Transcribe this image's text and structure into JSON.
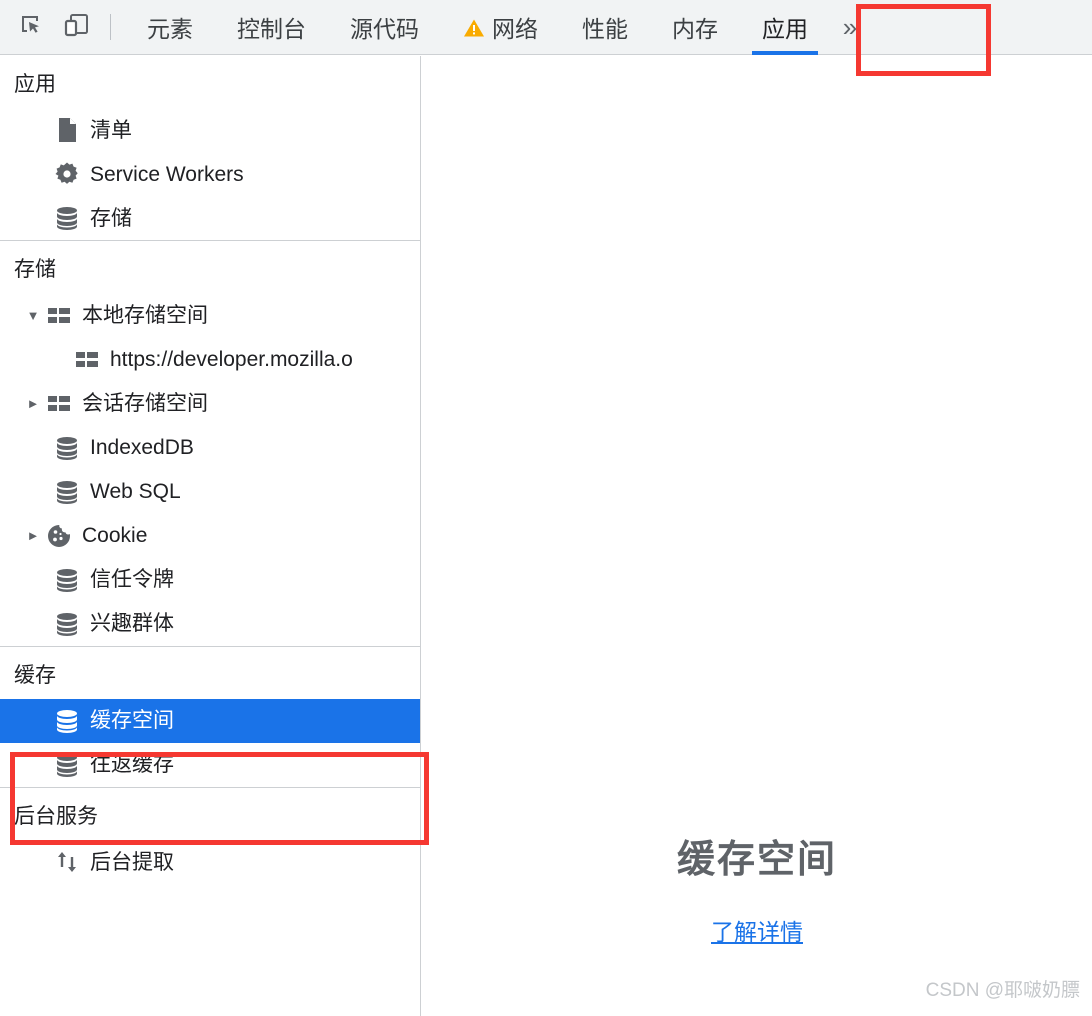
{
  "toolbar": {
    "icons": [
      {
        "name": "inspect-element-icon",
        "label": "检查元素"
      },
      {
        "name": "device-toolbar-icon",
        "label": "设备工具栏"
      }
    ],
    "tabs": [
      {
        "label": "元素",
        "active": false,
        "warning": false
      },
      {
        "label": "控制台",
        "active": false,
        "warning": false
      },
      {
        "label": "源代码",
        "active": false,
        "warning": false
      },
      {
        "label": "网络",
        "active": false,
        "warning": true
      },
      {
        "label": "性能",
        "active": false,
        "warning": false
      },
      {
        "label": "内存",
        "active": false,
        "warning": false
      },
      {
        "label": "应用",
        "active": true,
        "warning": false
      }
    ],
    "overflow_label": "»",
    "active_tab": "应用",
    "accent_color": "#1a73e8",
    "warning_color": "#f9ab00",
    "annotation_color": "#f53831"
  },
  "sidebar": {
    "sections": [
      {
        "title": "应用",
        "items": [
          {
            "label": "清单",
            "icon": "manifest-document-icon",
            "twisty": "none",
            "indent": 1,
            "selected": false
          },
          {
            "label": "Service Workers",
            "icon": "gear-icon",
            "twisty": "none",
            "indent": 1,
            "selected": false
          },
          {
            "label": "存储",
            "icon": "database-icon",
            "twisty": "none",
            "indent": 1,
            "selected": false
          }
        ]
      },
      {
        "title": "存储",
        "items": [
          {
            "label": "本地存储空间",
            "icon": "table-grid-icon",
            "twisty": "expanded",
            "indent": 0,
            "selected": false
          },
          {
            "label": "https://developer.mozilla.o",
            "icon": "table-grid-icon",
            "twisty": "none",
            "indent": 2,
            "selected": false
          },
          {
            "label": "会话存储空间",
            "icon": "table-grid-icon",
            "twisty": "collapsed",
            "indent": 0,
            "selected": false
          },
          {
            "label": "IndexedDB",
            "icon": "database-icon",
            "twisty": "none",
            "indent": 1,
            "selected": false
          },
          {
            "label": "Web SQL",
            "icon": "database-icon",
            "twisty": "none",
            "indent": 1,
            "selected": false
          },
          {
            "label": "Cookie",
            "icon": "cookie-icon",
            "twisty": "collapsed",
            "indent": 0,
            "selected": false
          },
          {
            "label": "信任令牌",
            "icon": "database-icon",
            "twisty": "none",
            "indent": 1,
            "selected": false
          },
          {
            "label": "兴趣群体",
            "icon": "database-icon",
            "twisty": "none",
            "indent": 1,
            "selected": false
          }
        ]
      },
      {
        "title": "缓存",
        "items": [
          {
            "label": "缓存空间",
            "icon": "database-icon",
            "twisty": "none",
            "indent": 1,
            "selected": true
          },
          {
            "label": "往返缓存",
            "icon": "database-icon",
            "twisty": "none",
            "indent": 1,
            "selected": false
          }
        ]
      },
      {
        "title": "后台服务",
        "items": [
          {
            "label": "后台提取",
            "icon": "background-fetch-arrows-icon",
            "twisty": "none",
            "indent": 1,
            "selected": false
          }
        ]
      }
    ]
  },
  "main": {
    "empty_title": "缓存空间",
    "learn_more_label": "了解详情",
    "watermark": "CSDN @耶啵奶膘"
  }
}
